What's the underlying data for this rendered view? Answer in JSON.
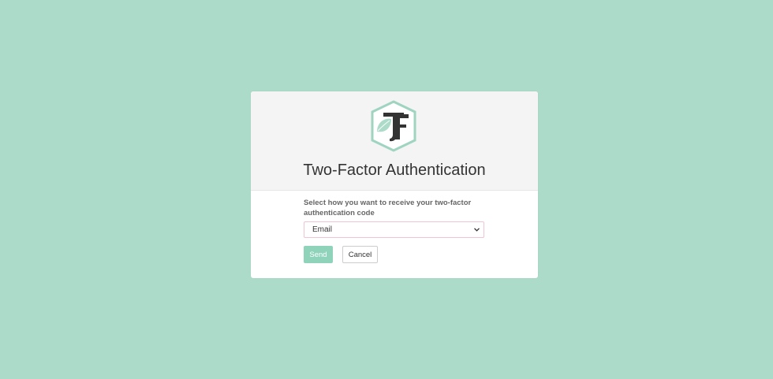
{
  "colors": {
    "page_background": "#acdbc9",
    "card_background": "#ffffff",
    "header_background": "#f4f4f4",
    "accent": "#8fd3bb",
    "logo_dark": "#333333",
    "logo_leaf": "#acdbc9"
  },
  "header": {
    "logo_icon": "tf-monogram-leaf-logo",
    "title": "Two-Factor Authentication"
  },
  "form": {
    "prompt": "Select how you want to receive your two-factor authentication code",
    "method_select": {
      "selected": "Email",
      "icon": "chevron-down-icon"
    },
    "send_label": "Send",
    "cancel_label": "Cancel"
  }
}
